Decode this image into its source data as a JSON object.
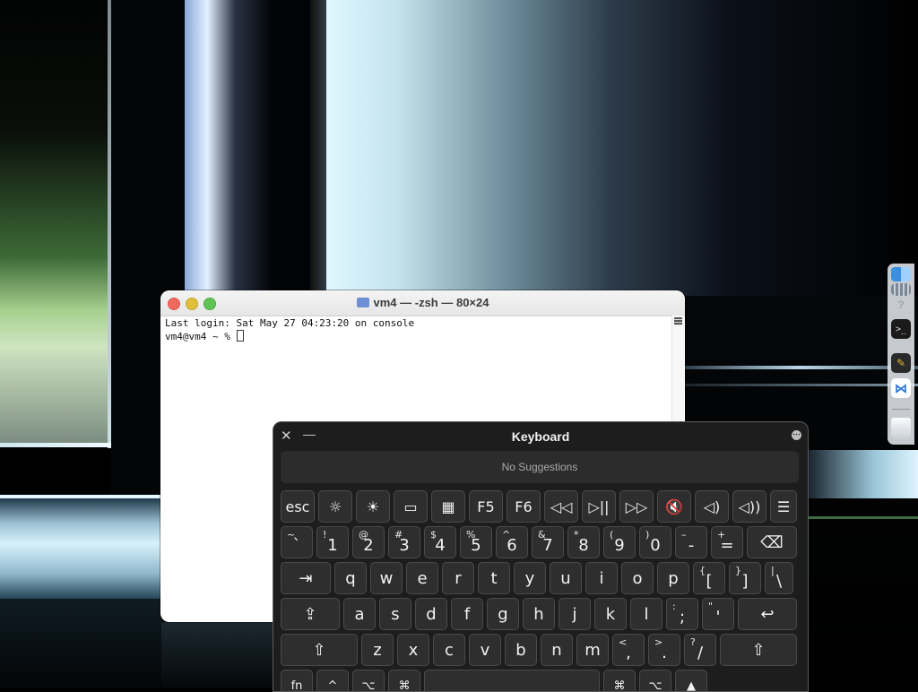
{
  "terminal": {
    "title": "vm4 — -zsh — 80×24",
    "lines": [
      "Last login: Sat May 27 04:23:20 on console",
      "vm4@vm4 ~ % "
    ]
  },
  "keyboard_viewer": {
    "title": "Keyboard",
    "close_glyph": "✕",
    "minimize_glyph": "—",
    "menu_glyph": "⋯",
    "suggestions_text": "No Suggestions",
    "rows": {
      "function": [
        {
          "label": "esc"
        },
        {
          "label": "☼"
        },
        {
          "label": "☀"
        },
        {
          "label": "▭"
        },
        {
          "label": "▦"
        },
        {
          "label": "F5"
        },
        {
          "label": "F6"
        },
        {
          "label": "◁◁"
        },
        {
          "label": "▷||"
        },
        {
          "label": "▷▷"
        },
        {
          "label": "🔇"
        },
        {
          "label": "◁)"
        },
        {
          "label": "◁))"
        },
        {
          "label": "☰"
        }
      ],
      "number": [
        {
          "shift": "~",
          "main": "`"
        },
        {
          "shift": "!",
          "main": "1"
        },
        {
          "shift": "@",
          "main": "2"
        },
        {
          "shift": "#",
          "main": "3"
        },
        {
          "shift": "$",
          "main": "4"
        },
        {
          "shift": "%",
          "main": "5"
        },
        {
          "shift": "^",
          "main": "6"
        },
        {
          "shift": "&",
          "main": "7"
        },
        {
          "shift": "*",
          "main": "8"
        },
        {
          "shift": "(",
          "main": "9"
        },
        {
          "shift": ")",
          "main": "0"
        },
        {
          "shift": "–",
          "main": "-"
        },
        {
          "shift": "+",
          "main": "="
        },
        {
          "shift": "",
          "main": "⌫"
        }
      ],
      "qwerty": [
        {
          "shift": "",
          "main": "⇥"
        },
        {
          "shift": "",
          "main": "q"
        },
        {
          "shift": "",
          "main": "w"
        },
        {
          "shift": "",
          "main": "e"
        },
        {
          "shift": "",
          "main": "r"
        },
        {
          "shift": "",
          "main": "t"
        },
        {
          "shift": "",
          "main": "y"
        },
        {
          "shift": "",
          "main": "u"
        },
        {
          "shift": "",
          "main": "i"
        },
        {
          "shift": "",
          "main": "o"
        },
        {
          "shift": "",
          "main": "p"
        },
        {
          "shift": "{",
          "main": "["
        },
        {
          "shift": "}",
          "main": "]"
        },
        {
          "shift": "|",
          "main": "\\"
        }
      ],
      "home": [
        {
          "shift": "",
          "main": "⇪"
        },
        {
          "shift": "",
          "main": "a"
        },
        {
          "shift": "",
          "main": "s"
        },
        {
          "shift": "",
          "main": "d"
        },
        {
          "shift": "",
          "main": "f"
        },
        {
          "shift": "",
          "main": "g"
        },
        {
          "shift": "",
          "main": "h"
        },
        {
          "shift": "",
          "main": "j"
        },
        {
          "shift": "",
          "main": "k"
        },
        {
          "shift": "",
          "main": "l"
        },
        {
          "shift": ":",
          "main": ";"
        },
        {
          "shift": "\"",
          "main": "'"
        },
        {
          "shift": "",
          "main": "↩"
        }
      ],
      "bottom": [
        {
          "shift": "",
          "main": "⇧"
        },
        {
          "shift": "",
          "main": "z"
        },
        {
          "shift": "",
          "main": "x"
        },
        {
          "shift": "",
          "main": "c"
        },
        {
          "shift": "",
          "main": "v"
        },
        {
          "shift": "",
          "main": "b"
        },
        {
          "shift": "",
          "main": "n"
        },
        {
          "shift": "",
          "main": "m"
        },
        {
          "shift": "<",
          "main": ","
        },
        {
          "shift": ">",
          "main": "."
        },
        {
          "shift": "?",
          "main": "/"
        },
        {
          "shift": "",
          "main": "⇧"
        }
      ],
      "modifier": [
        {
          "main": "fn"
        },
        {
          "main": "^"
        },
        {
          "main": "⌥"
        },
        {
          "main": "⌘"
        },
        {
          "main": ""
        },
        {
          "main": "⌘"
        },
        {
          "main": "⌥"
        },
        {
          "main": "▲"
        }
      ]
    }
  },
  "dock": {
    "items": [
      {
        "name": "finder-icon",
        "glyph": ""
      },
      {
        "name": "launchpad-icon",
        "glyph": ""
      },
      {
        "name": "help-icon",
        "glyph": "?"
      },
      {
        "name": "terminal-icon",
        "glyph": ">_"
      },
      {
        "name": "script-editor-icon",
        "glyph": "✎"
      },
      {
        "name": "vscode-icon",
        "glyph": "⋈"
      },
      {
        "name": "trash-icon",
        "glyph": ""
      }
    ]
  }
}
